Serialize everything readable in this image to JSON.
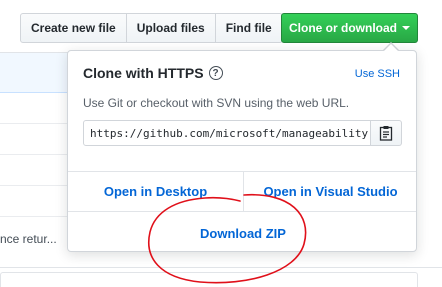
{
  "toolbar": {
    "create_new_file": "Create new file",
    "upload_files": "Upload files",
    "find_file": "Find file",
    "clone_or_download": "Clone or download"
  },
  "background": {
    "trailing_text": "nce retur..."
  },
  "clone_panel": {
    "title": "Clone with HTTPS",
    "help_glyph": "?",
    "use_ssh": "Use SSH",
    "description": "Use Git or checkout with SVN using the web URL.",
    "url_value": "https://github.com/microsoft/manageability",
    "open_desktop": "Open in Desktop",
    "open_visual_studio": "Open in Visual Studio",
    "download_zip": "Download ZIP"
  },
  "colors": {
    "primary_green": "#28a745",
    "link_blue": "#0366d6",
    "annotation_red": "#e0101a"
  }
}
